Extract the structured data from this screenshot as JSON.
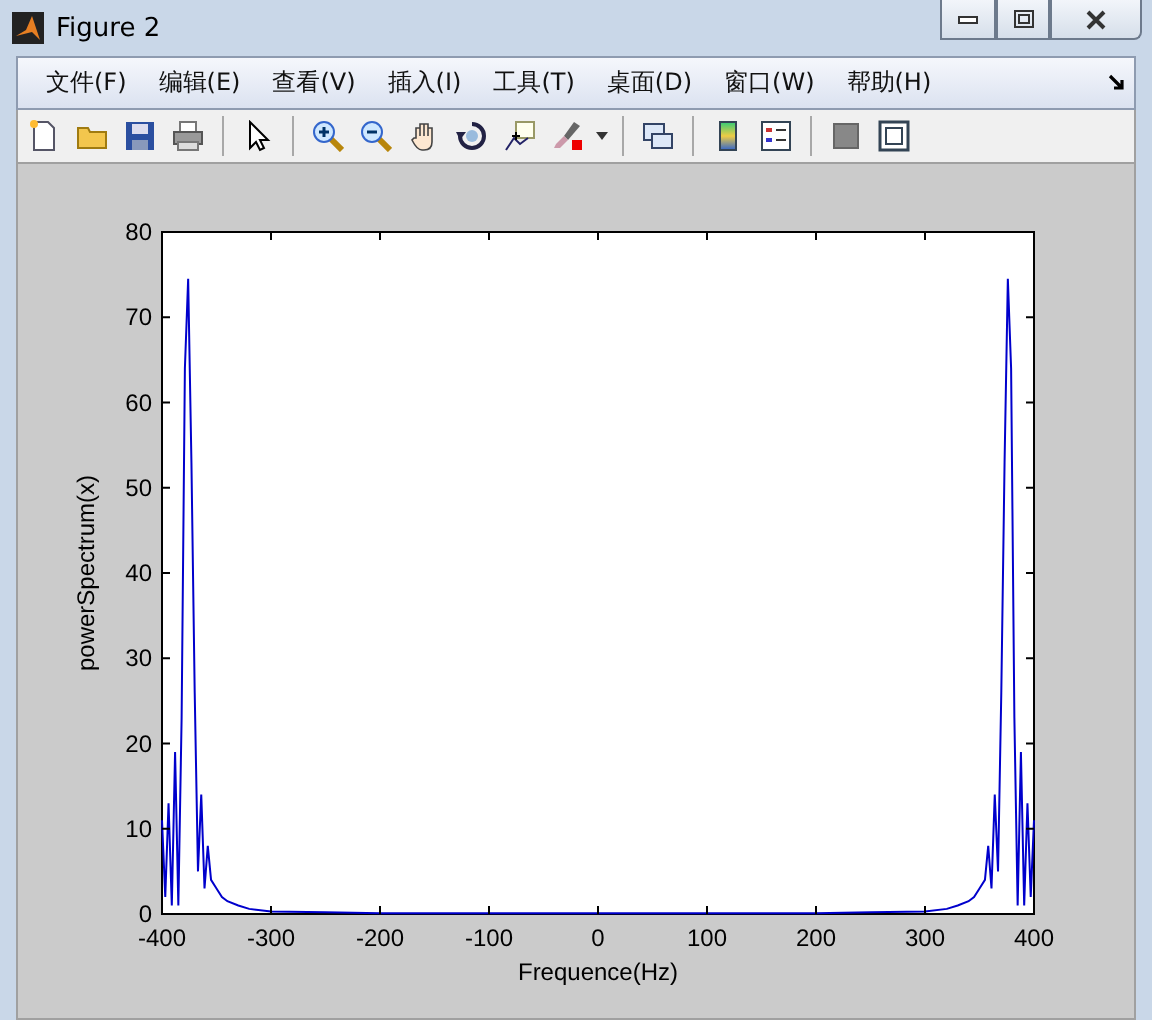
{
  "window": {
    "title": "Figure 2"
  },
  "menu": [
    "文件(F)",
    "编辑(E)",
    "查看(V)",
    "插入(I)",
    "工具(T)",
    "桌面(D)",
    "窗口(W)",
    "帮助(H)"
  ],
  "toolbar": [
    {
      "kind": "new"
    },
    {
      "kind": "open"
    },
    {
      "kind": "save"
    },
    {
      "kind": "print"
    },
    {
      "kind": "sep"
    },
    {
      "kind": "pointer"
    },
    {
      "kind": "sep"
    },
    {
      "kind": "zoomin"
    },
    {
      "kind": "zoomout"
    },
    {
      "kind": "pan"
    },
    {
      "kind": "rotate"
    },
    {
      "kind": "datacursor"
    },
    {
      "kind": "brush"
    },
    {
      "kind": "sep"
    },
    {
      "kind": "link"
    },
    {
      "kind": "sep"
    },
    {
      "kind": "colorbar"
    },
    {
      "kind": "legend"
    },
    {
      "kind": "sep"
    },
    {
      "kind": "hidetools"
    },
    {
      "kind": "showtools"
    }
  ],
  "chart_data": {
    "type": "line",
    "xlabel": "Frequence(Hz)",
    "ylabel": "powerSpectrum(x)",
    "xlim": [
      -400,
      400
    ],
    "ylim": [
      0,
      80
    ],
    "xticks": [
      -400,
      -300,
      -200,
      -100,
      0,
      100,
      200,
      300,
      400
    ],
    "yticks": [
      0,
      10,
      20,
      30,
      40,
      50,
      60,
      70,
      80
    ],
    "x": [
      -400,
      -397,
      -394,
      -391,
      -388,
      -385,
      -382,
      -379,
      -376,
      -373,
      -370,
      -367,
      -364,
      -361,
      -358,
      -355,
      -350,
      -345,
      -340,
      -330,
      -320,
      -300,
      -250,
      -200,
      -100,
      0,
      100,
      200,
      250,
      300,
      320,
      330,
      340,
      345,
      350,
      355,
      358,
      361,
      364,
      367,
      370,
      373,
      376,
      379,
      382,
      385,
      388,
      391,
      394,
      397,
      400
    ],
    "series": [
      {
        "color": "#0000cc",
        "values": [
          11,
          2,
          13,
          1,
          19,
          1,
          23,
          64,
          74.5,
          53,
          26,
          5,
          14,
          3,
          8,
          4,
          3,
          2,
          1.5,
          1,
          0.6,
          0.3,
          0.2,
          0.1,
          0.1,
          0.1,
          0.1,
          0.1,
          0.2,
          0.3,
          0.6,
          1,
          1.5,
          2,
          3,
          4,
          8,
          3,
          14,
          5,
          26,
          53,
          74.5,
          64,
          23,
          1,
          19,
          1,
          13,
          2,
          11
        ]
      }
    ]
  }
}
